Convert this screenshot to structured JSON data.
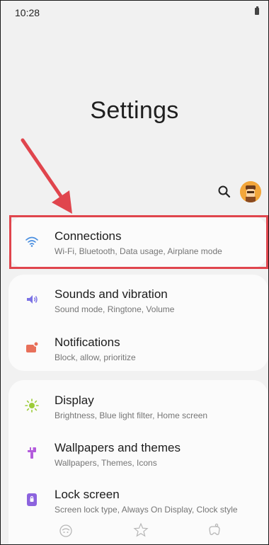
{
  "status_bar": {
    "time": "10:28"
  },
  "header": {
    "title": "Settings"
  },
  "groups": [
    {
      "items": [
        {
          "title": "Connections",
          "subtitle": "Wi-Fi, Bluetooth, Data usage, Airplane mode",
          "icon": "wifi-icon",
          "icon_color": "#4a8fe0"
        }
      ]
    },
    {
      "items": [
        {
          "title": "Sounds and vibration",
          "subtitle": "Sound mode, Ringtone, Volume",
          "icon": "volume-icon",
          "icon_color": "#7b72e5"
        },
        {
          "title": "Notifications",
          "subtitle": "Block, allow, prioritize",
          "icon": "notifications-icon",
          "icon_color": "#e8705a"
        }
      ]
    },
    {
      "items": [
        {
          "title": "Display",
          "subtitle": "Brightness, Blue light filter, Home screen",
          "icon": "brightness-icon",
          "icon_color": "#9ccc3a"
        },
        {
          "title": "Wallpapers and themes",
          "subtitle": "Wallpapers, Themes, Icons",
          "icon": "paintbrush-icon",
          "icon_color": "#b35bdc"
        },
        {
          "title": "Lock screen",
          "subtitle": "Screen lock type, Always On Display, Clock style",
          "icon": "lock-icon",
          "icon_color": "#8c63de"
        }
      ]
    }
  ],
  "annotation": {
    "color": "#e0454d"
  },
  "bottom_nav": [
    "game-icon",
    "star-icon",
    "gamepad-icon"
  ]
}
